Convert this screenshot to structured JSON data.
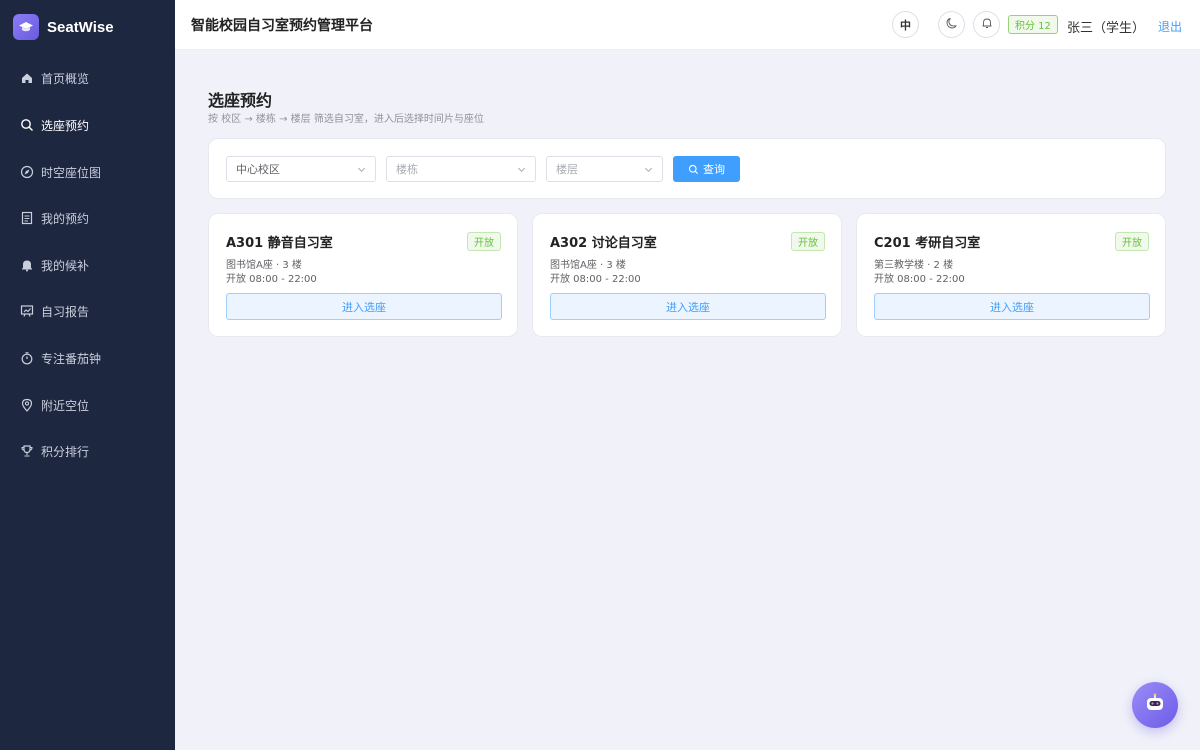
{
  "brand": {
    "name": "SeatWise"
  },
  "sidebar": {
    "items": [
      {
        "label": "首页概览",
        "icon": "home-icon"
      },
      {
        "label": "选座预约",
        "icon": "search-icon",
        "active": true
      },
      {
        "label": "时空座位图",
        "icon": "compass-icon"
      },
      {
        "label": "我的预约",
        "icon": "document-icon"
      },
      {
        "label": "我的候补",
        "icon": "bell-icon"
      },
      {
        "label": "自习报告",
        "icon": "report-icon"
      },
      {
        "label": "专注番茄钟",
        "icon": "timer-icon"
      },
      {
        "label": "附近空位",
        "icon": "location-icon"
      },
      {
        "label": "积分排行",
        "icon": "trophy-icon"
      }
    ]
  },
  "header": {
    "title": "智能校园自习室预约管理平台",
    "lang_label": "中",
    "points_label": "积分 12",
    "user_name": "张三（学生）",
    "logout_label": "退出"
  },
  "main": {
    "title": "选座预约",
    "subtitle": "按 校区 → 楼栋 → 楼层 筛选自习室，进入后选择时间片与座位",
    "filters": {
      "campus": "中心校区",
      "building_placeholder": "楼栋",
      "floor_placeholder": "楼层",
      "query_label": "查询"
    },
    "rooms": [
      {
        "name": "A301 静音自习室",
        "status": "开放",
        "location": "图书馆A座 · 3 楼",
        "hours": "开放 08:00 - 22:00",
        "action": "进入选座"
      },
      {
        "name": "A302 讨论自习室",
        "status": "开放",
        "location": "图书馆A座 · 3 楼",
        "hours": "开放 08:00 - 22:00",
        "action": "进入选座"
      },
      {
        "name": "C201 考研自习室",
        "status": "开放",
        "location": "第三教学楼 · 2 楼",
        "hours": "开放 08:00 - 22:00",
        "action": "进入选座"
      }
    ]
  },
  "colors": {
    "sidebar_bg": "#1e2740",
    "primary": "#409eff",
    "success": "#67c23a",
    "brand_accent": "#7b6cf0"
  }
}
